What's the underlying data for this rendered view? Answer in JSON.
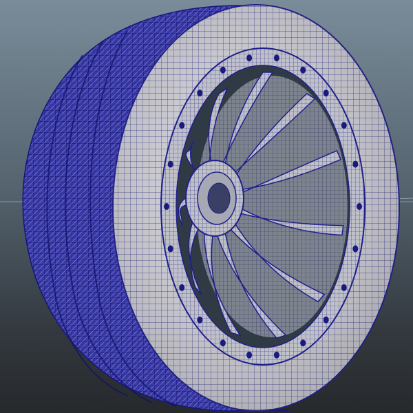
{
  "viewport": {
    "background_top": "#7a8c9a",
    "background_bottom": "#26292c",
    "wire_color": "#1f1f8a",
    "surface_color": "#c9c9cf",
    "tread_color": "#2a2a9a",
    "grid_color": "#b9c3cc"
  },
  "object": {
    "kind": "wheel-wireframe-model",
    "spoke_count": 11,
    "rim_bolt_count": 22
  }
}
